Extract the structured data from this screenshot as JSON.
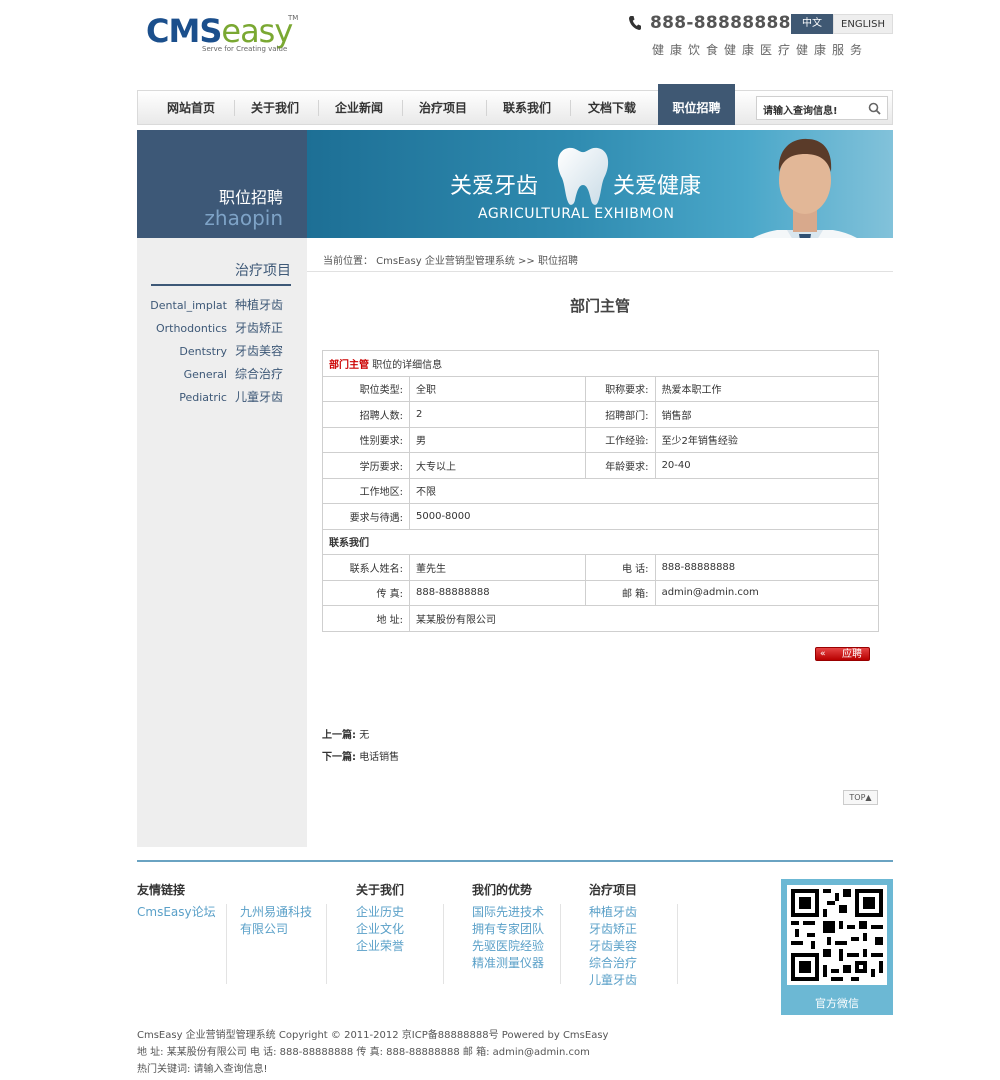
{
  "header": {
    "logo_cms": "CMS",
    "logo_easy": "easy",
    "logo_tm": "TM",
    "logo_slogan": "Serve for Creating value",
    "phone": "888-88888888",
    "lang_zh": "中文",
    "lang_en": "ENGLISH",
    "tagline": "健康饮食健康医疗健康服务"
  },
  "nav": {
    "items": [
      "网站首页",
      "关于我们",
      "企业新闻",
      "治疗项目",
      "联系我们",
      "文档下载",
      "职位招聘"
    ],
    "active": "职位招聘",
    "search_placeholder": "请输入查询信息!"
  },
  "banner": {
    "side_title": "职位招聘",
    "side_sub": "zhaopin",
    "text1": "关爱牙齿",
    "text2": "关爱健康",
    "text3": "AGRICULTURAL EXHIBMON"
  },
  "sidebar": {
    "title": "治疗项目",
    "items": [
      {
        "en": "Dental_implat",
        "zh": "种植牙齿"
      },
      {
        "en": "Orthodontics",
        "zh": "牙齿矫正"
      },
      {
        "en": "Dentstry",
        "zh": "牙齿美容"
      },
      {
        "en": "General",
        "zh": "综合治疗"
      },
      {
        "en": "Pediatric",
        "zh": "儿童牙齿"
      }
    ]
  },
  "breadcrumb": "当前位置： CmsEasy 企业营销型管理系统 >> 职位招聘",
  "job": {
    "title": "部门主管",
    "header_red": "部门主管",
    "header_rest": "职位的详细信息",
    "rows": [
      {
        "l1": "职位类型:",
        "v1": "全职",
        "l2": "职称要求:",
        "v2": "热爱本职工作"
      },
      {
        "l1": "招聘人数:",
        "v1": "2",
        "l2": "招聘部门:",
        "v2": "销售部"
      },
      {
        "l1": "性别要求:",
        "v1": "男",
        "l2": "工作经验:",
        "v2": "至少2年销售经验"
      },
      {
        "l1": "学历要求:",
        "v1": "大专以上",
        "l2": "年龄要求:",
        "v2": "20-40"
      }
    ],
    "area_label": "工作地区:",
    "area_value": "不限",
    "salary_label": "要求与待遇:",
    "salary_value": "5000-8000",
    "contact_header": "联系我们",
    "contact_name_label": "联系人姓名:",
    "contact_name": "董先生",
    "phone_label": "电 话:",
    "phone": "888-88888888",
    "fax_label": "传 真:",
    "fax": "888-88888888",
    "email_label": "邮 箱:",
    "email": "admin@admin.com",
    "addr_label": "地 址:",
    "addr": "某某股份有限公司",
    "apply_arrow": "«",
    "apply": "应聘"
  },
  "prev_label": "上一篇:",
  "prev_value": "无",
  "next_label": "下一篇:",
  "next_value": "电话销售",
  "top_btn": "TOP▲",
  "footer": {
    "links_title": "友情链接",
    "links": [
      "CmsEasy论坛",
      "九州易通科技",
      "有限公司"
    ],
    "about_title": "关于我们",
    "about": [
      "企业历史",
      "企业文化",
      "企业荣誉"
    ],
    "adv_title": "我们的优势",
    "adv": [
      "国际先进技术",
      "拥有专家团队",
      "先驱医院经验",
      "精准测量仪器"
    ],
    "treat_title": "治疗项目",
    "treat": [
      "种植牙齿",
      "牙齿矫正",
      "牙齿美容",
      "综合治疗",
      "儿童牙齿"
    ],
    "qr_caption": "官方微信",
    "copy1": "CmsEasy 企业营销型管理系统  Copyright © 2011-2012  京ICP备88888888号  Powered by CmsEasy",
    "copy2": "地 址:  某某股份有限公司  电 话:  888-88888888  传 真:  888-88888888  邮 箱:  admin@admin.com",
    "copy3": "热门关键词:  请输入查询信息!"
  }
}
